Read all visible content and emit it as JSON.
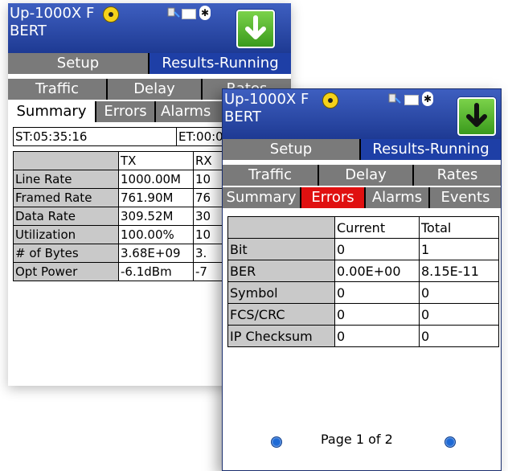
{
  "colors": {
    "title_bar": "#1e3a93",
    "tab_active_blue": "#1e3fa6",
    "tab_inactive": "#7a7a7a",
    "tab_alert": "#e01010",
    "accent_green": "#3a9a1c"
  },
  "back": {
    "title": "Up-1000X F\nBERT",
    "main_tabs": [
      "Setup",
      "Results-Running"
    ],
    "sub_tabs": [
      "Traffic",
      "Delay",
      "Rates"
    ],
    "view_tabs": [
      "Summary",
      "Errors",
      "Alarms"
    ],
    "start_time": "ST:05:35:16",
    "end_time": "ET:00:00",
    "headers": [
      "",
      "TX",
      "RX"
    ],
    "rows": [
      {
        "label": "Line Rate",
        "tx": "1000.00M",
        "rx": "10"
      },
      {
        "label": "Framed Rate",
        "tx": "761.90M",
        "rx": "76"
      },
      {
        "label": "Data Rate",
        "tx": "309.52M",
        "rx": "30"
      },
      {
        "label": "Utilization",
        "tx": "100.00%",
        "rx": "10"
      },
      {
        "label": "# of Bytes",
        "tx": "3.68E+09",
        "rx": "3."
      },
      {
        "label": "Opt Power",
        "tx": "-6.1dBm",
        "rx": "-7"
      }
    ]
  },
  "front": {
    "title": "Up-1000X F\nBERT",
    "main_tabs": [
      "Setup",
      "Results-Running"
    ],
    "sub_tabs": [
      "Traffic",
      "Delay",
      "Rates"
    ],
    "view_tabs": [
      "Summary",
      "Errors",
      "Alarms",
      "Events"
    ],
    "headers": [
      "",
      "Current",
      "Total"
    ],
    "rows": [
      {
        "label": "Bit",
        "current": "0",
        "total": "1"
      },
      {
        "label": "BER",
        "current": "0.00E+00",
        "total": "8.15E-11"
      },
      {
        "label": "Symbol",
        "current": "0",
        "total": "0"
      },
      {
        "label": "FCS/CRC",
        "current": "0",
        "total": "0"
      },
      {
        "label": "IP Checksum",
        "current": "0",
        "total": "0"
      }
    ],
    "page_text": "Page 1 of 2"
  },
  "icons": [
    "status-yellow-icon",
    "ethernet-plug-icon",
    "battery-icon",
    "bluetooth-icon",
    "download-arrow-icon",
    "prev-page-icon",
    "next-page-icon"
  ]
}
